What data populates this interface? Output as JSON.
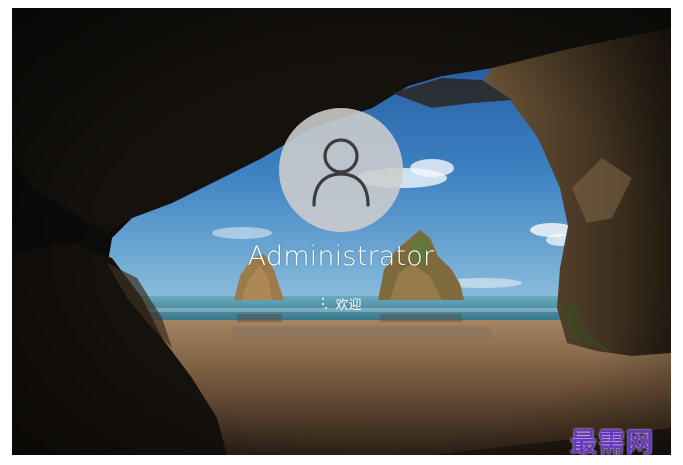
{
  "lock_screen": {
    "user": {
      "display_name": "Administrator",
      "avatar_icon": "user-silhouette-icon"
    },
    "status": {
      "spinner_icon": "loading-dots-icon",
      "text": "欢迎"
    }
  },
  "watermark": {
    "text": "最需网"
  },
  "colors": {
    "sky": "#2a6fb3",
    "sea": "#3f8fa8",
    "sand": "#8b6a4a",
    "rock": "#2e2418",
    "avatar_bg": "#cdcdcd",
    "watermark": "#6a37c4"
  }
}
